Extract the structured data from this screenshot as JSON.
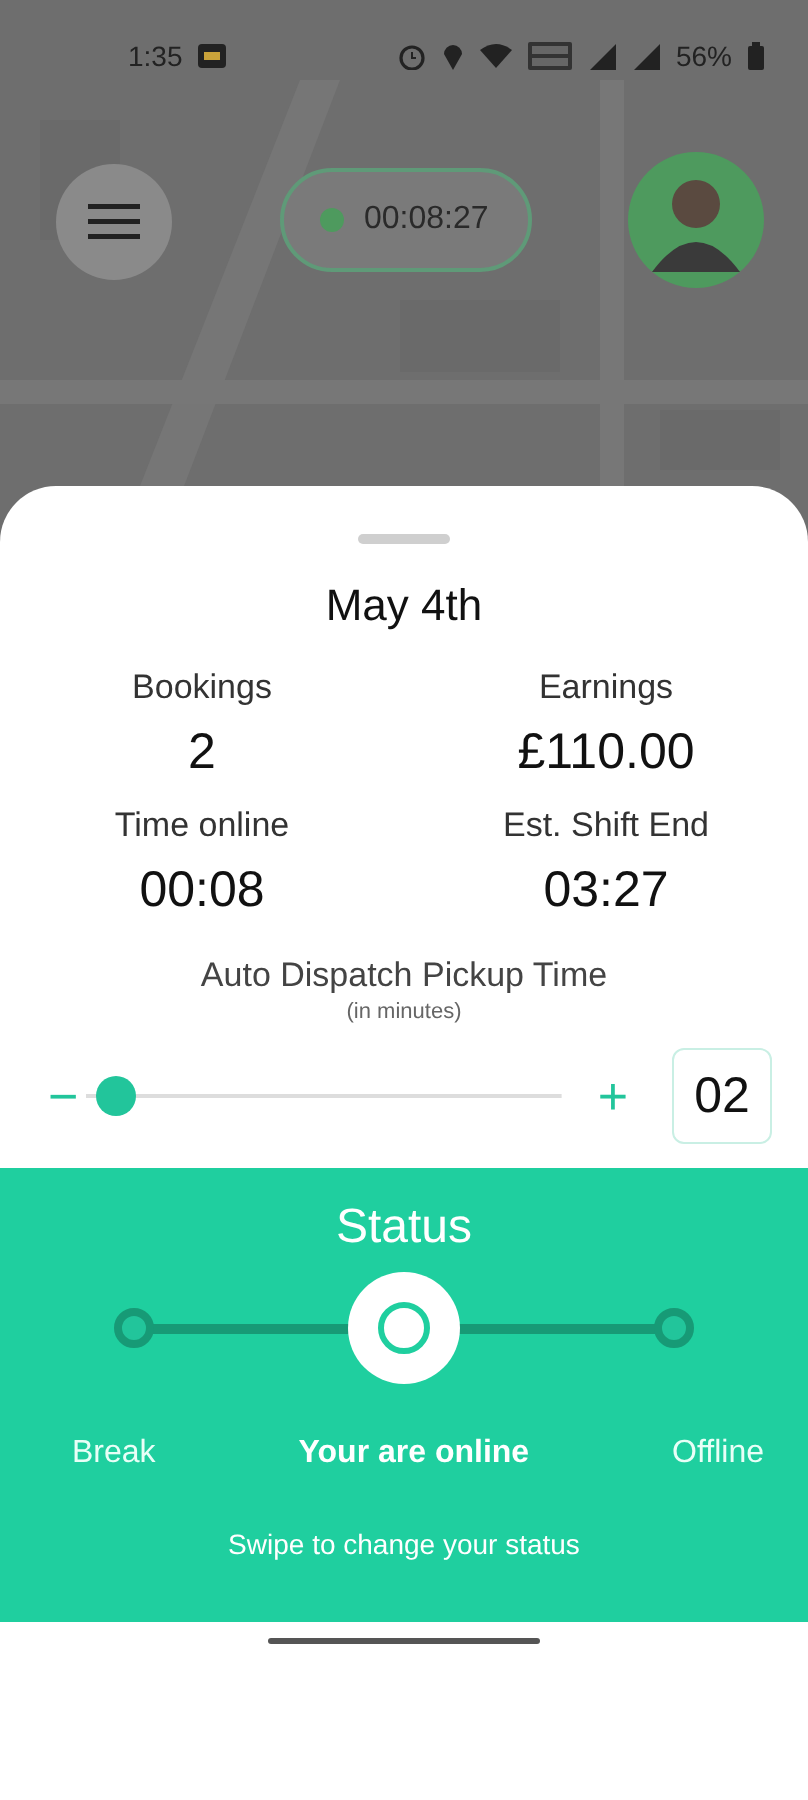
{
  "status_bar": {
    "time": "1:35",
    "battery": "56%"
  },
  "map_overlay": {
    "timer": "00:08:27",
    "online": true
  },
  "sheet": {
    "date": "May 4th",
    "stats": [
      {
        "label": "Bookings",
        "value": "2"
      },
      {
        "label": "Earnings",
        "value": "£110.00"
      },
      {
        "label": "Time online",
        "value": "00:08"
      },
      {
        "label": "Est. Shift End",
        "value": "03:27"
      }
    ],
    "dispatch": {
      "title": "Auto Dispatch Pickup Time",
      "unit": "(in minutes)",
      "decrease": "−",
      "increase": "+",
      "level": 0.02,
      "value": "02"
    }
  },
  "status": {
    "title": "Status",
    "hint": "Swipe to change your status",
    "options": [
      {
        "label": "Break",
        "selected": false
      },
      {
        "label": "Your are online",
        "selected": true
      },
      {
        "label": "Offline",
        "selected": false
      }
    ]
  }
}
